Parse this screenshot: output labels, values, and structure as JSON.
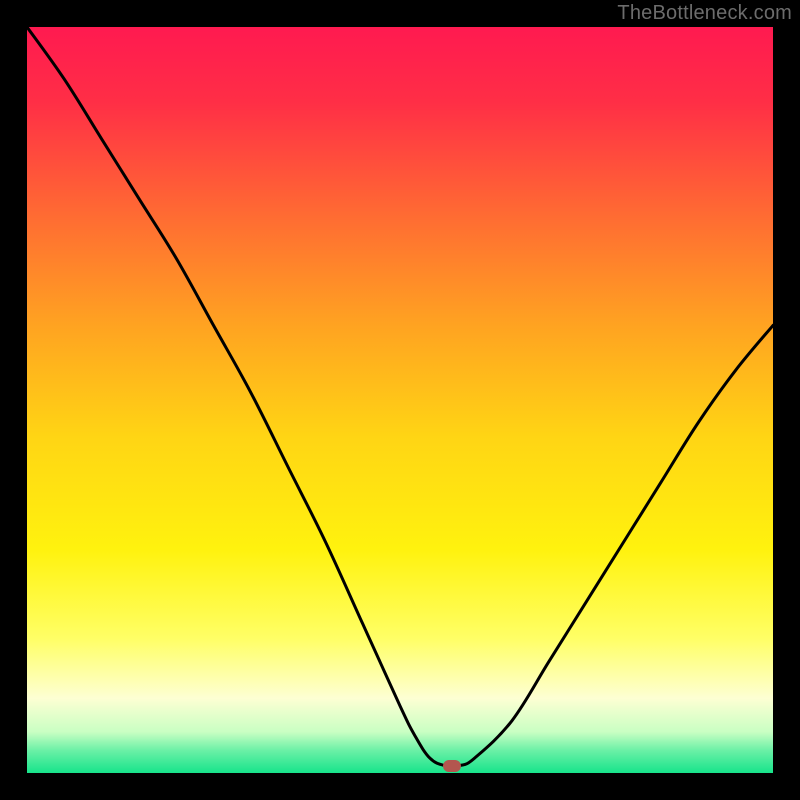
{
  "watermark": {
    "text": "TheBottleneck.com"
  },
  "colors": {
    "frame": "#000000",
    "curve_stroke": "#000000",
    "marker_fill": "#b3564f",
    "watermark": "#6c6c6c",
    "gradient_stops": [
      {
        "offset": 0.0,
        "color": "#ff1a50"
      },
      {
        "offset": 0.1,
        "color": "#ff2e46"
      },
      {
        "offset": 0.25,
        "color": "#ff6a33"
      },
      {
        "offset": 0.4,
        "color": "#ffa321"
      },
      {
        "offset": 0.55,
        "color": "#ffd514"
      },
      {
        "offset": 0.7,
        "color": "#fff20e"
      },
      {
        "offset": 0.82,
        "color": "#ffff66"
      },
      {
        "offset": 0.9,
        "color": "#fdffd3"
      },
      {
        "offset": 0.945,
        "color": "#c9ffc3"
      },
      {
        "offset": 0.97,
        "color": "#6af0a6"
      },
      {
        "offset": 1.0,
        "color": "#17e48b"
      }
    ]
  },
  "plot": {
    "axis_range": {
      "x": [
        0,
        100
      ],
      "y": [
        0,
        100
      ]
    }
  },
  "chart_data": {
    "type": "line",
    "title": "",
    "xlabel": "",
    "ylabel": "",
    "xlim": [
      0,
      100
    ],
    "ylim": [
      0,
      100
    ],
    "grid": false,
    "legend": false,
    "series": [
      {
        "name": "bottleneck-curve",
        "x": [
          0,
          5,
          10,
          15,
          20,
          25,
          30,
          35,
          40,
          45,
          50,
          52,
          54,
          56,
          58,
          60,
          65,
          70,
          75,
          80,
          85,
          90,
          95,
          100
        ],
        "y": [
          100,
          93,
          85,
          77,
          69,
          60,
          51,
          41,
          31,
          20,
          9,
          5,
          2,
          1,
          1,
          2,
          7,
          15,
          23,
          31,
          39,
          47,
          54,
          60
        ]
      }
    ],
    "marker": {
      "x": 57,
      "y": 1
    },
    "annotations": []
  }
}
